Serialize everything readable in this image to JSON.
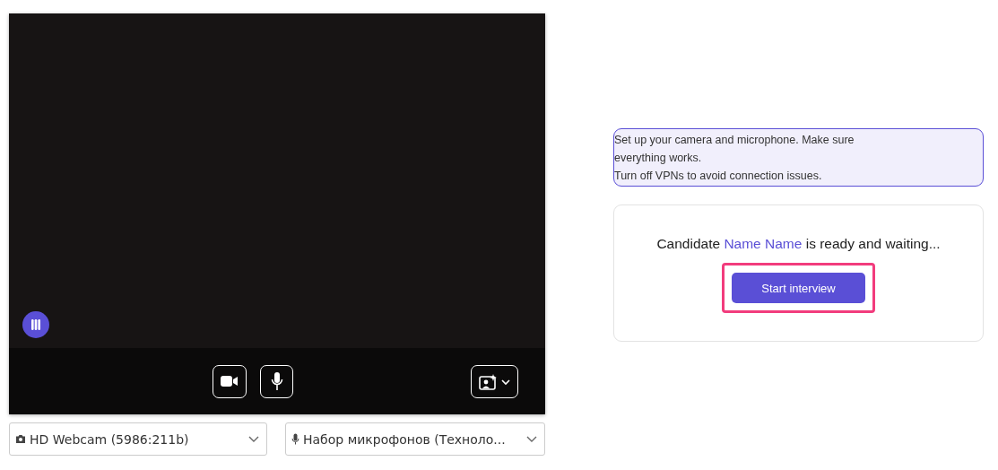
{
  "video": {
    "controls": [
      {
        "kind": "camera"
      },
      {
        "kind": "microphone"
      }
    ],
    "effects": {
      "kind": "effects"
    }
  },
  "devices": [
    {
      "kind": "camera",
      "value": "HD Webcam (5986:211b)"
    },
    {
      "kind": "microphone",
      "value": "Набор микрофонов (Техноло..."
    }
  ],
  "notice": [
    "Set up your camera and microphone. Make sure everything works.",
    "Turn off VPNs to avoid connection issues."
  ],
  "status": {
    "prefix": "Candidate",
    "name": "Name Name",
    "suffix": "is ready and waiting..."
  },
  "start_button": {
    "label": "Start interview",
    "highlighted": true
  }
}
